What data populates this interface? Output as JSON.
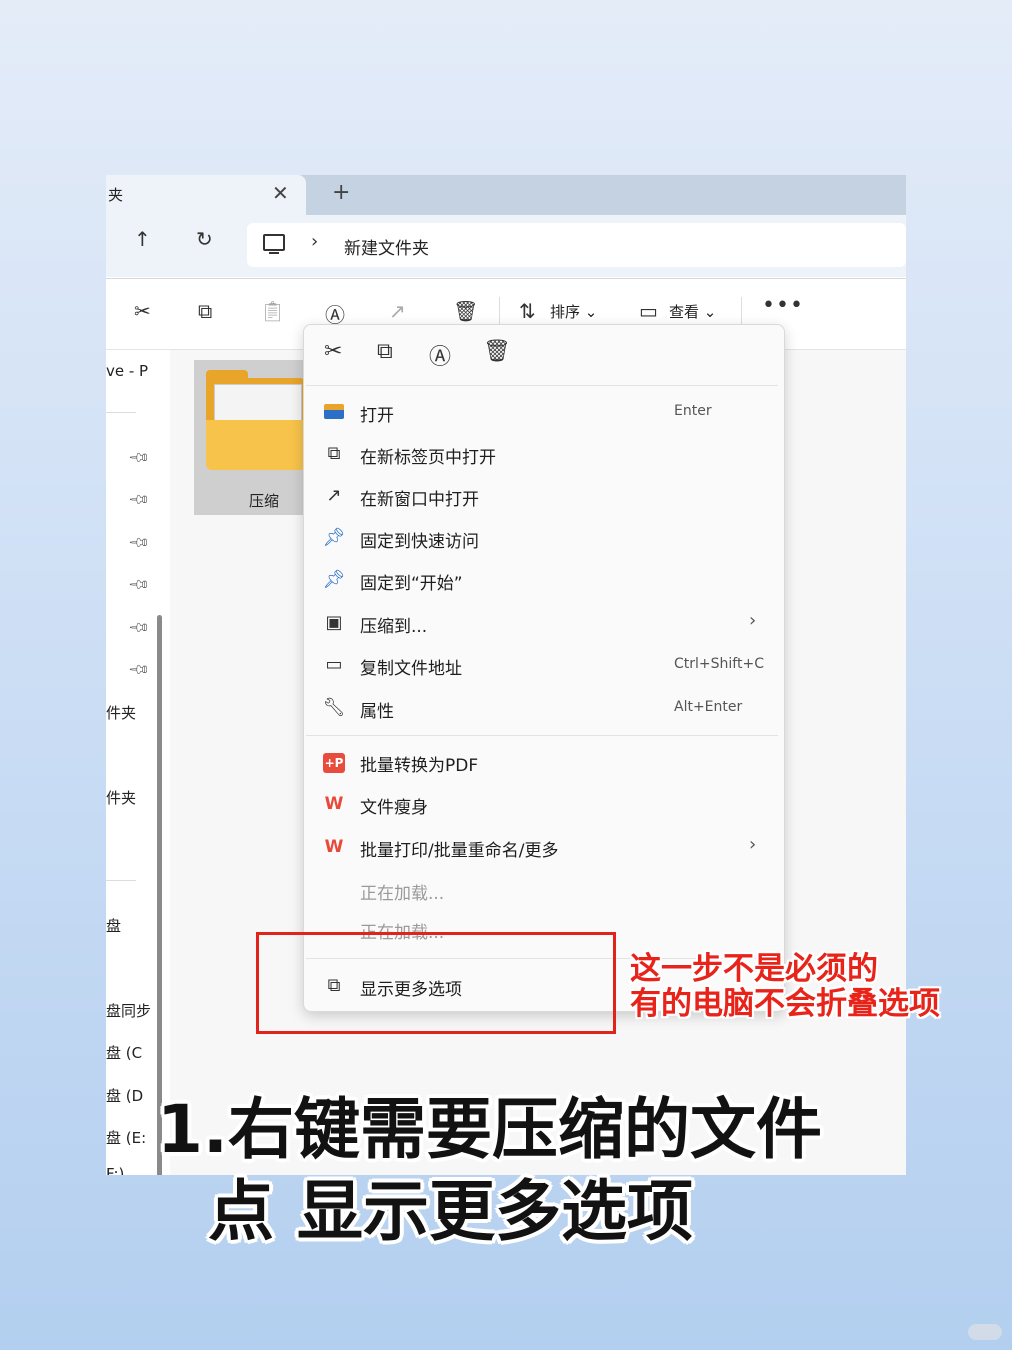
{
  "window": {
    "tab_title": "夹",
    "tab_close": "✕",
    "new_tab": "+",
    "nav_up": "↑",
    "nav_refresh": "↻",
    "address_separator": "›",
    "address_path": "新建文件夹"
  },
  "toolbar": {
    "sort_label": "排序",
    "view_label": "查看",
    "more_label": "•••",
    "dropdown_caret": "⌄"
  },
  "sidebar": {
    "items": [
      "ve - P",
      "件夹",
      "件夹",
      "盘",
      "盘同步",
      "盘 (C",
      "盘 (D",
      "盘 (E:",
      "F:)"
    ]
  },
  "content": {
    "folder_name": "压缩"
  },
  "context_menu": {
    "items": [
      {
        "label": "打开",
        "shortcut": "Enter"
      },
      {
        "label": "在新标签页中打开",
        "shortcut": ""
      },
      {
        "label": "在新窗口中打开",
        "shortcut": ""
      },
      {
        "label": "固定到快速访问",
        "shortcut": ""
      },
      {
        "label": "固定到“开始”",
        "shortcut": ""
      },
      {
        "label": "压缩到...",
        "shortcut": "",
        "submenu": true
      },
      {
        "label": "复制文件地址",
        "shortcut": "Ctrl+Shift+C"
      },
      {
        "label": "属性",
        "shortcut": "Alt+Enter"
      },
      {
        "label": "批量转换为PDF",
        "shortcut": ""
      },
      {
        "label": "文件瘦身",
        "shortcut": ""
      },
      {
        "label": "批量打印/批量重命名/更多",
        "shortcut": "",
        "submenu": true
      },
      {
        "label": "正在加载...",
        "shortcut": ""
      },
      {
        "label": "正在加载...",
        "shortcut": ""
      },
      {
        "label": "显示更多选项",
        "shortcut": ""
      }
    ],
    "submenu_arrow": "›",
    "pdf_badge": "+P",
    "wps_badge": "W"
  },
  "annotation": {
    "note_line1": "这一步不是必须的",
    "note_line2": "有的电脑不会折叠选项",
    "highlight_color": "#e0241b"
  },
  "caption": {
    "line1": "1.右键需要压缩的文件",
    "line2": "点  显示更多选项"
  }
}
